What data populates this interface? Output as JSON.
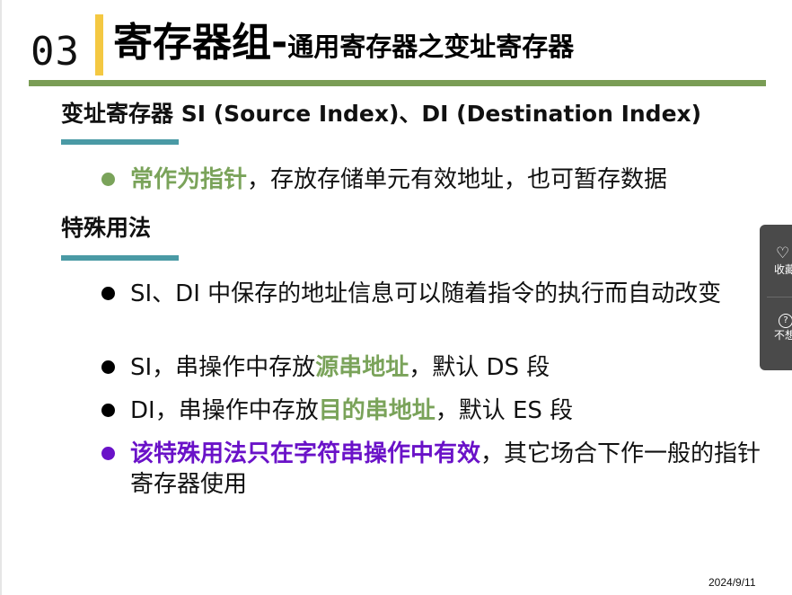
{
  "slide": {
    "number": "03",
    "title_main": "寄存器组",
    "title_dash": "-",
    "title_sub": "通用寄存器之变址寄存器"
  },
  "section1": {
    "heading": "变址寄存器 SI (Source Index)、DI (Destination Index)",
    "bullets": [
      {
        "highlight": "常作为指针",
        "text": "，存放存储单元有效地址，也可暂存数据",
        "color": "#7aa35a"
      }
    ]
  },
  "section2": {
    "heading": "特殊用法",
    "bullets": [
      {
        "text": "SI、DI 中保存的地址信息可以随着指令的执行而自动改变",
        "color": "#000000"
      },
      {
        "pre": "SI，串操作中存放",
        "highlight": "源串地址",
        "post": "，默认 DS 段",
        "color": "#000000"
      },
      {
        "pre": "DI，串操作中存放",
        "highlight": "目的串地址",
        "post": "，默认 ES 段",
        "color": "#000000"
      },
      {
        "highlight": "该特殊用法只在字符串操作中有效",
        "post": "，其它场合下作一般的指针寄存器使用",
        "color": "#6a12c8"
      }
    ]
  },
  "footer": {
    "date": "2024/9/11"
  },
  "side_panel": {
    "items": [
      {
        "icon": "heart-icon",
        "label": "收藏"
      },
      {
        "icon": "question-icon",
        "label": "不想"
      }
    ]
  },
  "colors": {
    "accent_yellow": "#f4c842",
    "rule_green": "#7a9d55",
    "underline_teal": "#4a9aa5",
    "highlight_green": "#7aa35a",
    "highlight_purple": "#6a12c8"
  }
}
